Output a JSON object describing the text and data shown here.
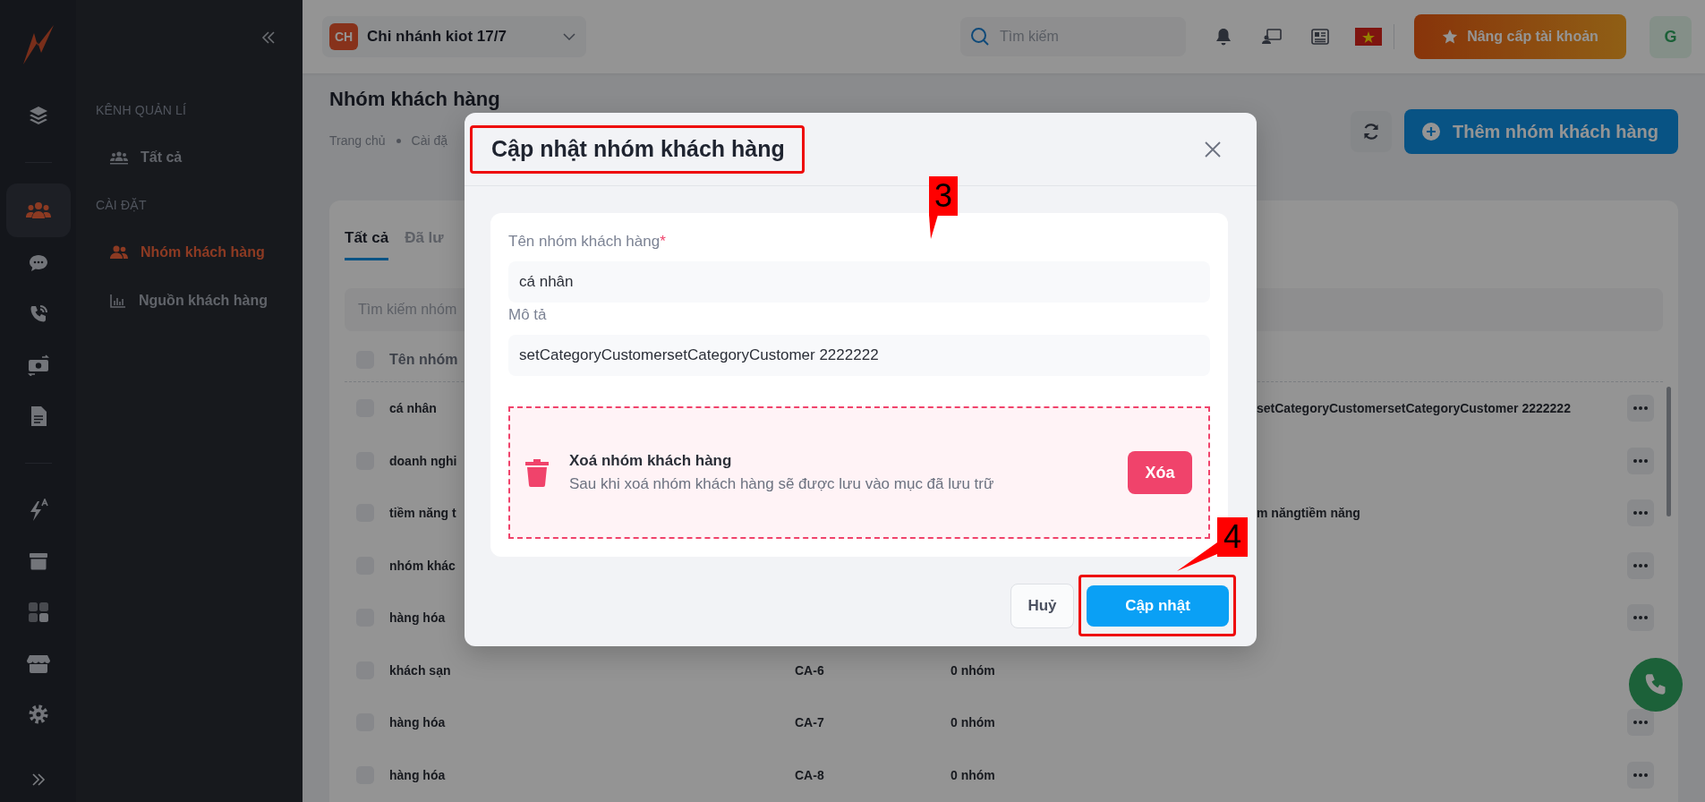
{
  "rail": {
    "items": [
      {
        "selected": false
      },
      {
        "selected": true
      },
      {
        "selected": false
      },
      {
        "selected": false
      },
      {
        "selected": false
      },
      {
        "selected": false
      },
      {
        "selected": false
      },
      {
        "selected": false
      },
      {
        "selected": false
      },
      {
        "selected": false
      },
      {
        "selected": false
      }
    ]
  },
  "sidebar": {
    "sections": [
      {
        "title": "KÊNH QUẢN LÍ",
        "items": [
          {
            "label": "Tất cả",
            "selected": false
          }
        ]
      },
      {
        "title": "CÀI ĐẶT",
        "items": [
          {
            "label": "Nhóm khách hàng",
            "selected": true
          },
          {
            "label": "Nguồn khách hàng",
            "selected": false
          }
        ]
      }
    ]
  },
  "topbar": {
    "branch": {
      "badge": "CH",
      "name": "Chi nhánh kiot 17/7"
    },
    "search": {
      "placeholder": "Tìm kiếm"
    },
    "upgrade_button": "Nâng cấp tài khoản",
    "avatar": "G"
  },
  "page": {
    "title": "Nhóm khách hàng",
    "breadcrumb": [
      "Trang chủ",
      "Cài đặ"
    ],
    "add_button": "Thêm nhóm khách hàng"
  },
  "card": {
    "tabs": [
      {
        "label": "Tất cả",
        "selected": true
      },
      {
        "label": "Đã lư",
        "selected": false
      }
    ],
    "search": {
      "placeholder": "Tìm kiếm nhóm"
    },
    "table": {
      "header": {
        "checked": false,
        "column_1": "Tên nhóm"
      },
      "rows": [
        {
          "checked": false,
          "name": "cá nhân",
          "description": "setCategoryCustomersetCategoryCustomer 2222222",
          "has_menu": true
        },
        {
          "checked": false,
          "name": "doanh nghi",
          "has_menu": true
        },
        {
          "checked": false,
          "name": "tiềm năng t",
          "description": "m năngtiềm năng",
          "has_menu": true
        },
        {
          "checked": false,
          "name": "nhóm khác",
          "has_menu": true
        },
        {
          "checked": false,
          "name": "hàng hóa",
          "has_menu": true
        },
        {
          "checked": false,
          "name": "khách sạn",
          "code": "CA-6",
          "count": "0 nhóm",
          "has_menu": false
        },
        {
          "checked": false,
          "name": "hàng hóa",
          "code": "CA-7",
          "count": "0 nhóm",
          "has_menu": true
        },
        {
          "checked": false,
          "name": "hàng hóa",
          "code": "CA-8",
          "count": "0 nhóm",
          "has_menu": true
        }
      ]
    }
  },
  "dialog": {
    "title": "Cập nhật nhóm khách hàng",
    "fields": [
      {
        "label": "Tên nhóm khách hàng",
        "required_mark": "*",
        "value": "cá nhân"
      },
      {
        "label": "Mô tả",
        "value": "setCategoryCustomersetCategoryCustomer 2222222"
      }
    ],
    "danger": {
      "title": "Xoá nhóm khách hàng",
      "description": "Sau khi xoá nhóm khách hàng sẽ được lưu vào mục đã lưu trữ",
      "button": "Xóa"
    },
    "cancel_button": "Huỷ",
    "submit_button": "Cập nhật"
  },
  "annotations": [
    {
      "label": "3"
    },
    {
      "label": "4"
    }
  ]
}
